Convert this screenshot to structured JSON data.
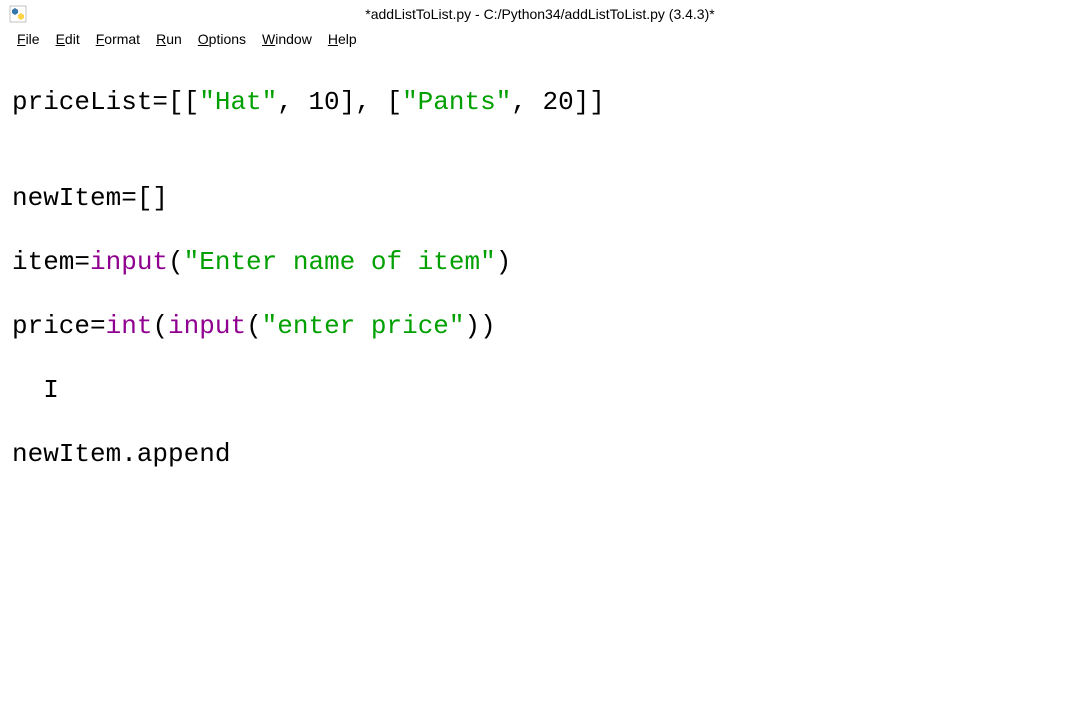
{
  "title": "*addListToList.py - C:/Python34/addListToList.py (3.4.3)*",
  "menu": {
    "file": "File",
    "edit": "Edit",
    "format": "Format",
    "run": "Run",
    "options": "Options",
    "window": "Window",
    "help": "Help"
  },
  "code": {
    "l1": {
      "a": "priceList=[[",
      "b": "\"Hat\"",
      "c": ", 10], [",
      "d": "\"Pants\"",
      "e": ", 20]]"
    },
    "l2": "",
    "l3": "newItem=[]",
    "l4": {
      "a": "item=",
      "b": "input",
      "c": "(",
      "d": "\"Enter name of item\"",
      "e": ")"
    },
    "l5": {
      "a": "price=",
      "b": "int",
      "c": "(",
      "d": "input",
      "e": "(",
      "f": "\"enter price\"",
      "g": "))"
    },
    "l6_cursor": "  I",
    "l7": "newItem.append"
  }
}
